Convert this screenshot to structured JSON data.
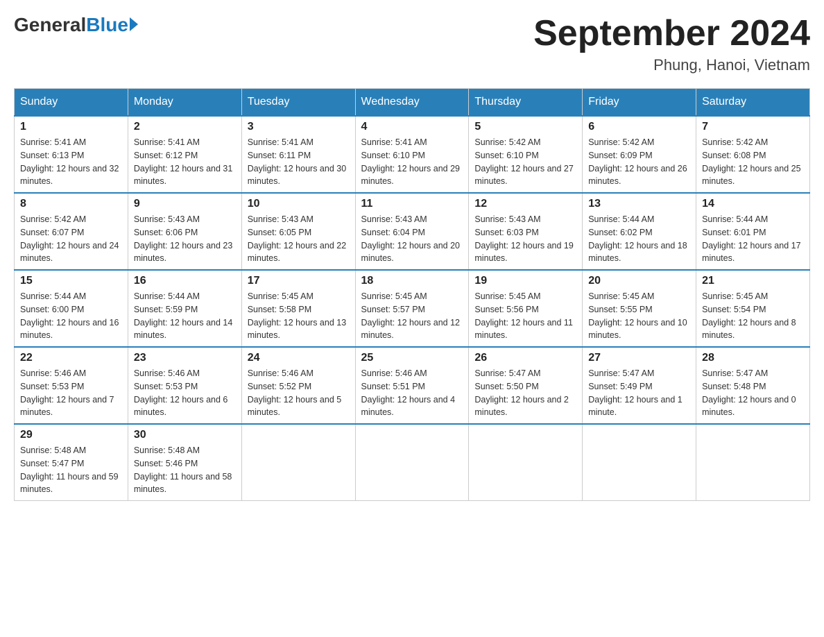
{
  "header": {
    "logo": {
      "general": "General",
      "blue": "Blue"
    },
    "title": "September 2024",
    "location": "Phung, Hanoi, Vietnam"
  },
  "days_of_week": [
    "Sunday",
    "Monday",
    "Tuesday",
    "Wednesday",
    "Thursday",
    "Friday",
    "Saturday"
  ],
  "weeks": [
    [
      {
        "day": "1",
        "sunrise": "Sunrise: 5:41 AM",
        "sunset": "Sunset: 6:13 PM",
        "daylight": "Daylight: 12 hours and 32 minutes."
      },
      {
        "day": "2",
        "sunrise": "Sunrise: 5:41 AM",
        "sunset": "Sunset: 6:12 PM",
        "daylight": "Daylight: 12 hours and 31 minutes."
      },
      {
        "day": "3",
        "sunrise": "Sunrise: 5:41 AM",
        "sunset": "Sunset: 6:11 PM",
        "daylight": "Daylight: 12 hours and 30 minutes."
      },
      {
        "day": "4",
        "sunrise": "Sunrise: 5:41 AM",
        "sunset": "Sunset: 6:10 PM",
        "daylight": "Daylight: 12 hours and 29 minutes."
      },
      {
        "day": "5",
        "sunrise": "Sunrise: 5:42 AM",
        "sunset": "Sunset: 6:10 PM",
        "daylight": "Daylight: 12 hours and 27 minutes."
      },
      {
        "day": "6",
        "sunrise": "Sunrise: 5:42 AM",
        "sunset": "Sunset: 6:09 PM",
        "daylight": "Daylight: 12 hours and 26 minutes."
      },
      {
        "day": "7",
        "sunrise": "Sunrise: 5:42 AM",
        "sunset": "Sunset: 6:08 PM",
        "daylight": "Daylight: 12 hours and 25 minutes."
      }
    ],
    [
      {
        "day": "8",
        "sunrise": "Sunrise: 5:42 AM",
        "sunset": "Sunset: 6:07 PM",
        "daylight": "Daylight: 12 hours and 24 minutes."
      },
      {
        "day": "9",
        "sunrise": "Sunrise: 5:43 AM",
        "sunset": "Sunset: 6:06 PM",
        "daylight": "Daylight: 12 hours and 23 minutes."
      },
      {
        "day": "10",
        "sunrise": "Sunrise: 5:43 AM",
        "sunset": "Sunset: 6:05 PM",
        "daylight": "Daylight: 12 hours and 22 minutes."
      },
      {
        "day": "11",
        "sunrise": "Sunrise: 5:43 AM",
        "sunset": "Sunset: 6:04 PM",
        "daylight": "Daylight: 12 hours and 20 minutes."
      },
      {
        "day": "12",
        "sunrise": "Sunrise: 5:43 AM",
        "sunset": "Sunset: 6:03 PM",
        "daylight": "Daylight: 12 hours and 19 minutes."
      },
      {
        "day": "13",
        "sunrise": "Sunrise: 5:44 AM",
        "sunset": "Sunset: 6:02 PM",
        "daylight": "Daylight: 12 hours and 18 minutes."
      },
      {
        "day": "14",
        "sunrise": "Sunrise: 5:44 AM",
        "sunset": "Sunset: 6:01 PM",
        "daylight": "Daylight: 12 hours and 17 minutes."
      }
    ],
    [
      {
        "day": "15",
        "sunrise": "Sunrise: 5:44 AM",
        "sunset": "Sunset: 6:00 PM",
        "daylight": "Daylight: 12 hours and 16 minutes."
      },
      {
        "day": "16",
        "sunrise": "Sunrise: 5:44 AM",
        "sunset": "Sunset: 5:59 PM",
        "daylight": "Daylight: 12 hours and 14 minutes."
      },
      {
        "day": "17",
        "sunrise": "Sunrise: 5:45 AM",
        "sunset": "Sunset: 5:58 PM",
        "daylight": "Daylight: 12 hours and 13 minutes."
      },
      {
        "day": "18",
        "sunrise": "Sunrise: 5:45 AM",
        "sunset": "Sunset: 5:57 PM",
        "daylight": "Daylight: 12 hours and 12 minutes."
      },
      {
        "day": "19",
        "sunrise": "Sunrise: 5:45 AM",
        "sunset": "Sunset: 5:56 PM",
        "daylight": "Daylight: 12 hours and 11 minutes."
      },
      {
        "day": "20",
        "sunrise": "Sunrise: 5:45 AM",
        "sunset": "Sunset: 5:55 PM",
        "daylight": "Daylight: 12 hours and 10 minutes."
      },
      {
        "day": "21",
        "sunrise": "Sunrise: 5:45 AM",
        "sunset": "Sunset: 5:54 PM",
        "daylight": "Daylight: 12 hours and 8 minutes."
      }
    ],
    [
      {
        "day": "22",
        "sunrise": "Sunrise: 5:46 AM",
        "sunset": "Sunset: 5:53 PM",
        "daylight": "Daylight: 12 hours and 7 minutes."
      },
      {
        "day": "23",
        "sunrise": "Sunrise: 5:46 AM",
        "sunset": "Sunset: 5:53 PM",
        "daylight": "Daylight: 12 hours and 6 minutes."
      },
      {
        "day": "24",
        "sunrise": "Sunrise: 5:46 AM",
        "sunset": "Sunset: 5:52 PM",
        "daylight": "Daylight: 12 hours and 5 minutes."
      },
      {
        "day": "25",
        "sunrise": "Sunrise: 5:46 AM",
        "sunset": "Sunset: 5:51 PM",
        "daylight": "Daylight: 12 hours and 4 minutes."
      },
      {
        "day": "26",
        "sunrise": "Sunrise: 5:47 AM",
        "sunset": "Sunset: 5:50 PM",
        "daylight": "Daylight: 12 hours and 2 minutes."
      },
      {
        "day": "27",
        "sunrise": "Sunrise: 5:47 AM",
        "sunset": "Sunset: 5:49 PM",
        "daylight": "Daylight: 12 hours and 1 minute."
      },
      {
        "day": "28",
        "sunrise": "Sunrise: 5:47 AM",
        "sunset": "Sunset: 5:48 PM",
        "daylight": "Daylight: 12 hours and 0 minutes."
      }
    ],
    [
      {
        "day": "29",
        "sunrise": "Sunrise: 5:48 AM",
        "sunset": "Sunset: 5:47 PM",
        "daylight": "Daylight: 11 hours and 59 minutes."
      },
      {
        "day": "30",
        "sunrise": "Sunrise: 5:48 AM",
        "sunset": "Sunset: 5:46 PM",
        "daylight": "Daylight: 11 hours and 58 minutes."
      },
      null,
      null,
      null,
      null,
      null
    ]
  ]
}
